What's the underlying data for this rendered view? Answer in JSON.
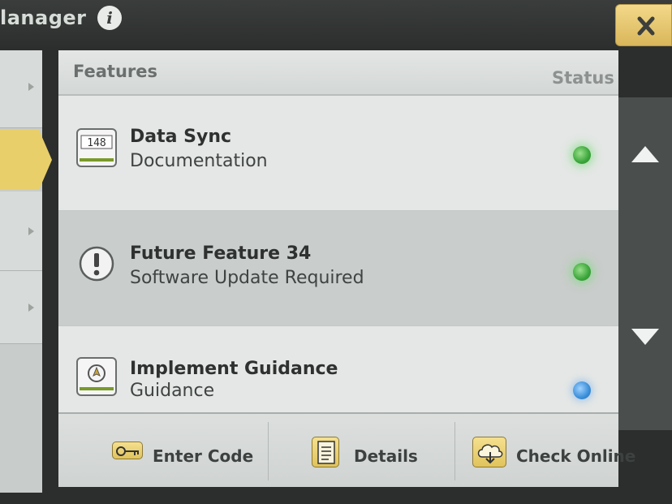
{
  "window": {
    "title": "lanager"
  },
  "header": {
    "info_icon": "info-icon",
    "close_icon": "close-icon"
  },
  "table": {
    "col_features": "Features",
    "col_status": "Status"
  },
  "features": [
    {
      "title": "Data Sync",
      "subtitle": "Documentation",
      "icon": "counter-icon",
      "status": "green"
    },
    {
      "title": "Future Feature 34",
      "subtitle": "Software Update Required",
      "icon": "warning-icon",
      "status": "green"
    },
    {
      "title": "Implement Guidance",
      "subtitle": "Guidance",
      "icon": "guidance-icon",
      "status": "blue"
    }
  ],
  "toolbar": {
    "enter_code": "Enter Code",
    "details": "Details",
    "check_online": "Check Online"
  },
  "counter_digits": "148",
  "colors": {
    "accent": "#e8cf6a",
    "status_green": "#3aa53a",
    "status_blue": "#3a8ed8"
  }
}
